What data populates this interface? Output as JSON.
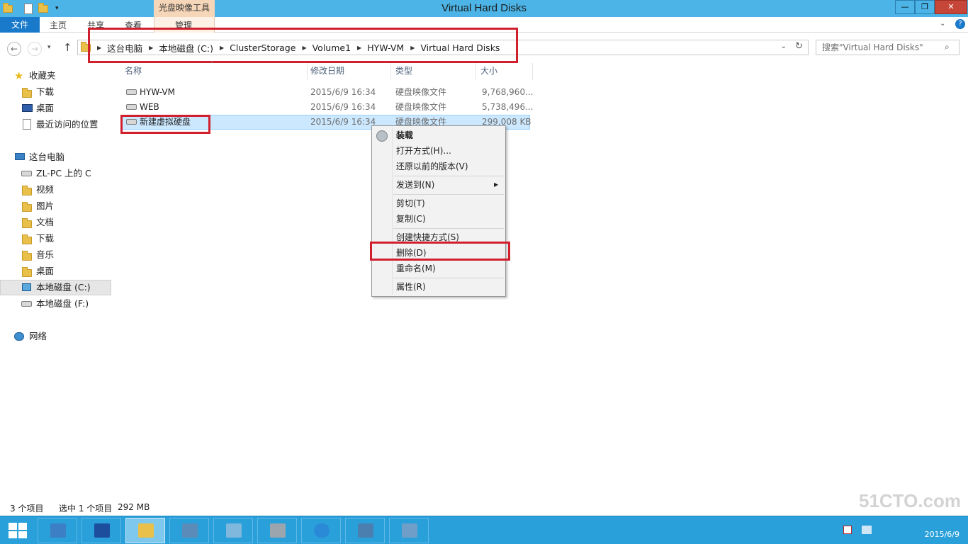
{
  "window": {
    "title": "Virtual Hard Disks",
    "contextual_group": "光盘映像工具",
    "btn_minimize": "—",
    "btn_maximize": "❐",
    "btn_close": "✕"
  },
  "ribbon": {
    "file": "文件",
    "home": "主页",
    "share": "共享",
    "view": "查看",
    "manage": "管理"
  },
  "address": {
    "crumbs": [
      "这台电脑",
      "本地磁盘 (C:)",
      "ClusterStorage",
      "Volume1",
      "HYW-VM",
      "Virtual Hard Disks"
    ],
    "search_placeholder": "搜索\"Virtual Hard Disks\""
  },
  "navpane": {
    "favorites": "收藏夹",
    "fav_items": [
      "下载",
      "桌面",
      "最近访问的位置"
    ],
    "this_pc": "这台电脑",
    "pc_items": [
      "ZL-PC 上的 C",
      "视频",
      "图片",
      "文档",
      "下载",
      "音乐",
      "桌面",
      "本地磁盘 (C:)",
      "本地磁盘 (F:)"
    ],
    "network": "网络"
  },
  "columns": {
    "name": "名称",
    "date": "修改日期",
    "type": "类型",
    "size": "大小"
  },
  "files": [
    {
      "name": "HYW-VM",
      "date": "2015/6/9 16:34",
      "type": "硬盘映像文件",
      "size": "9,768,960..."
    },
    {
      "name": "WEB",
      "date": "2015/6/9 16:34",
      "type": "硬盘映像文件",
      "size": "5,738,496..."
    },
    {
      "name": "新建虚拟硬盘",
      "date": "2015/6/9 16:34",
      "type": "硬盘映像文件",
      "size": "299,008 KB"
    }
  ],
  "context_menu": {
    "mount": "装载",
    "open_with": "打开方式(H)...",
    "restore": "还原以前的版本(V)",
    "send_to": "发送到(N)",
    "cut": "剪切(T)",
    "copy": "复制(C)",
    "shortcut": "创建快捷方式(S)",
    "delete": "删除(D)",
    "rename": "重命名(M)",
    "properties": "属性(R)"
  },
  "status": {
    "count": "3 个项目",
    "selected": "选中 1 个项目",
    "size": "292 MB"
  },
  "taskbar": {
    "date": "2015/6/9",
    "watermark": "51CTO.com"
  },
  "colors": {
    "titlebar": "#4cb4e6",
    "file_tab": "#1979ca",
    "annotation": "#d0202e",
    "selection": "#cce8ff",
    "taskbar": "#2aa0db"
  }
}
